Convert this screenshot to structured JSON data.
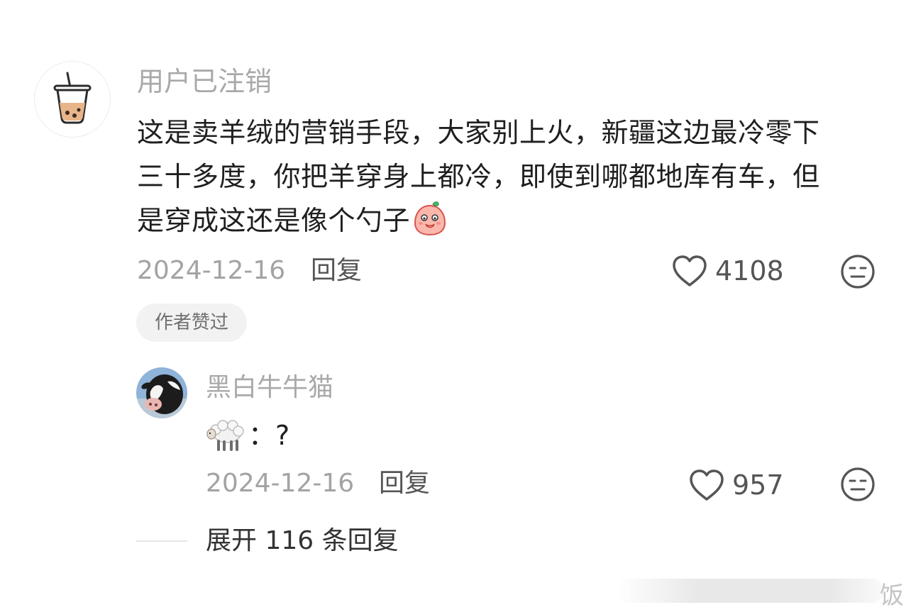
{
  "comment": {
    "username": "用户已注销",
    "avatar_icon": "bubble-tea-icon",
    "text_lines": [
      "这是卖羊绒的营销手段，大家别上火，新疆这边最冷零下",
      "三十多度，你把羊穿身上都冷，即使到哪都地库有车，但",
      "是穿成这还是像个勺子"
    ],
    "text_emoji": "covering-mouth-blob-emoji",
    "date": "2024-12-16",
    "reply_label": "回复",
    "like_count": "4108",
    "author_badge": "作者赞过"
  },
  "reply": {
    "username": "黑白牛牛猫",
    "avatar_icon": "cow-avatar",
    "emoji": "sheep-emoji",
    "text": "：?",
    "date": "2024-12-16",
    "reply_label": "回复",
    "like_count": "957"
  },
  "expand": {
    "label": "展开 116 条回复"
  },
  "watermark": {
    "text": "饭"
  },
  "colors": {
    "text_primary": "#1f1f1f",
    "text_secondary": "#a9a9a9",
    "badge_bg": "#f2f2f2",
    "icon_stroke": "#555555"
  }
}
